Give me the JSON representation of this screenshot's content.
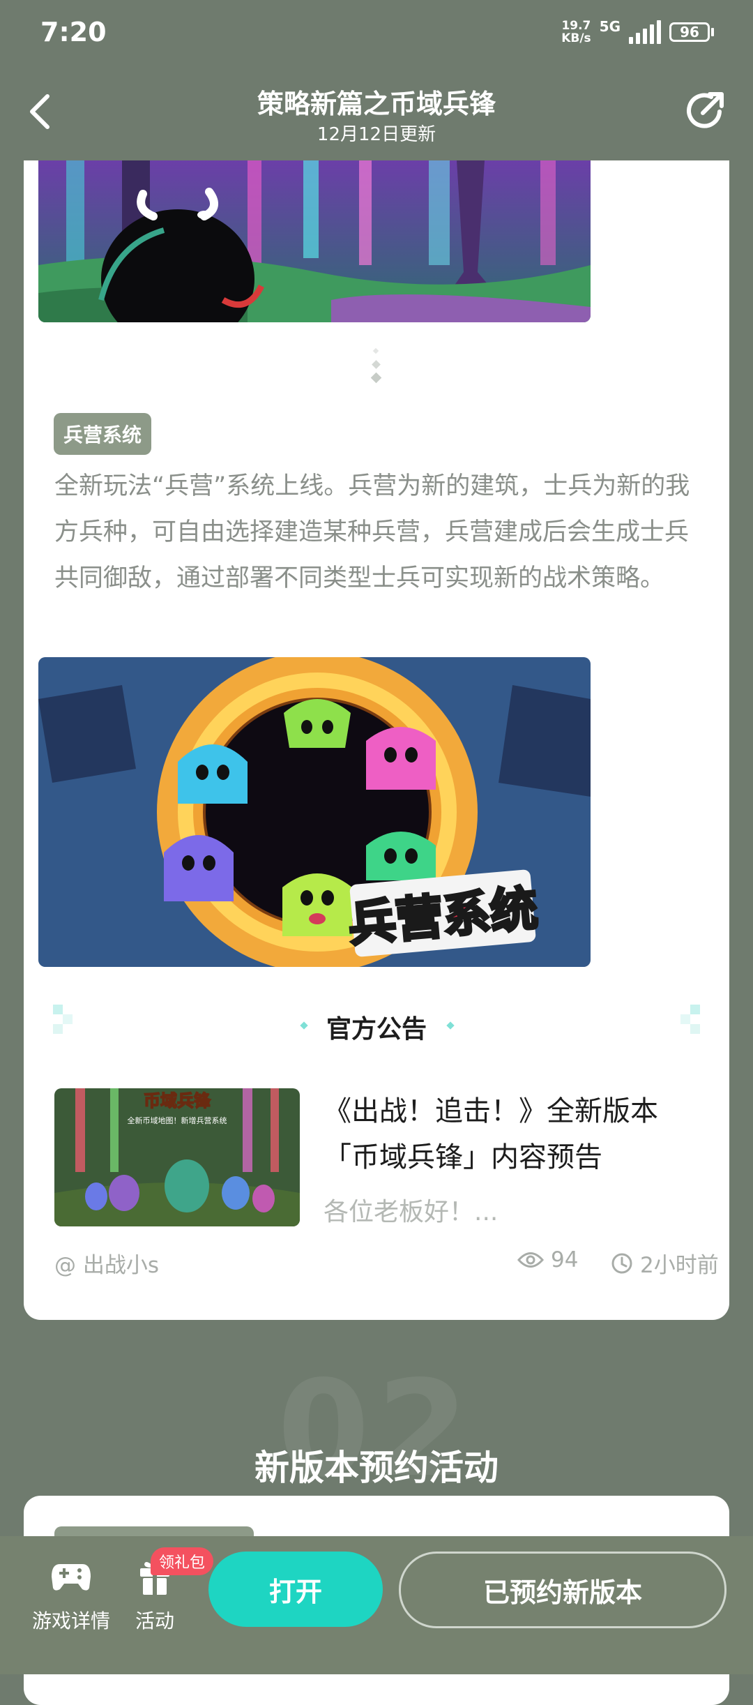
{
  "status_bar": {
    "time": "7:20",
    "net_speed_value": "19.7",
    "net_speed_unit": "KB/s",
    "network": "5G",
    "battery": "96"
  },
  "header": {
    "title": "策略新篇之币域兵锋",
    "subtitle": "12月12日更新",
    "back_icon": "chevron-left-icon",
    "share_icon": "share-arrow-icon"
  },
  "section1": {
    "tag": "兵营系统",
    "description": "全新玩法“兵营”系统上线。兵营为新的建筑，士兵为新的我方兵种，可自由选择建造某种兵营，兵营建成后会生成士兵共同御敌，通过部署不同类型士兵可实现新的战术策略。",
    "image_text": "兵营系统",
    "announcement_title": "官方公告",
    "news": {
      "thumb_title": "币域兵锋",
      "thumb_sub": "全新币域地图！新增兵营系统",
      "title": "《出战！追击！》全新版本「币域兵锋」内容预告",
      "excerpt": "各位老板好！...",
      "author": "@ 出战小s",
      "views": "94",
      "time_ago": "2小时前"
    }
  },
  "section2": {
    "number": "02",
    "title": "新版本预约活动"
  },
  "bottom_bar": {
    "game_details": "游戏详情",
    "activity": "活动",
    "gift_badge": "领礼包",
    "open_button": "打开",
    "reserved_button": "已预约新版本"
  },
  "colors": {
    "page_bg": "#6f7b6e",
    "accent_teal": "#1ed5c2",
    "tag_bg": "#8d9a88",
    "badge_red": "#f4515f"
  }
}
